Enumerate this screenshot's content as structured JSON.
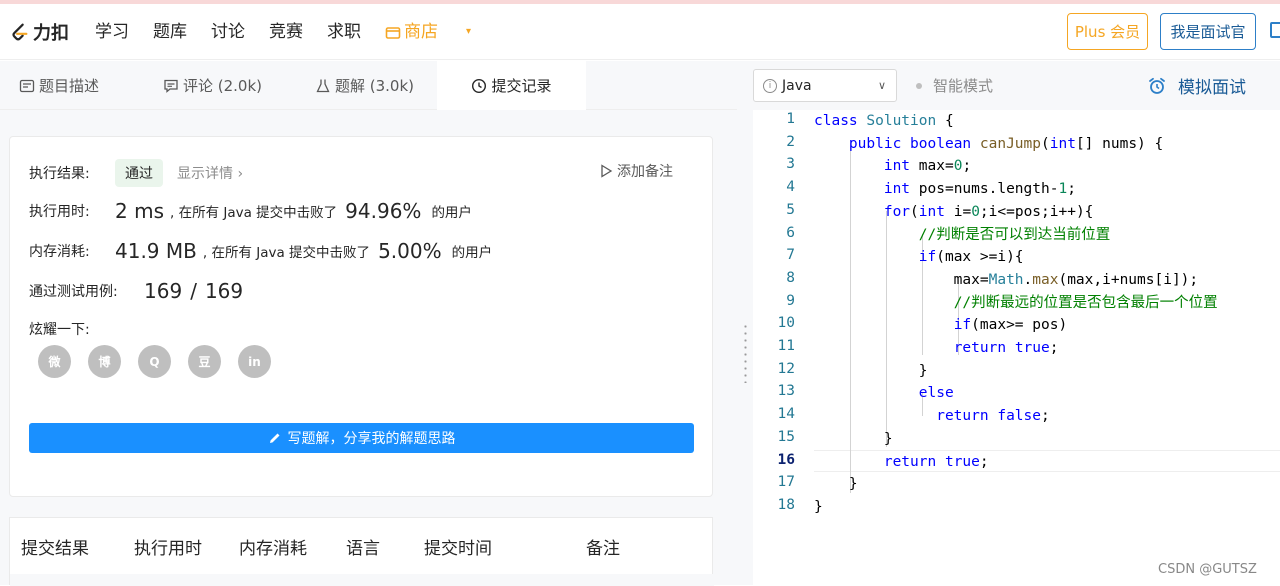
{
  "navbar": {
    "logo_text": "力扣",
    "links": [
      "学习",
      "题库",
      "讨论",
      "竞赛",
      "求职"
    ],
    "shop_label": "商店",
    "plus_label": "Plus 会员",
    "interviewer_label": "我是面试官",
    "accent_color": "#f5a623"
  },
  "tabs": [
    {
      "label": "题目描述",
      "icon": "description-icon"
    },
    {
      "label": "评论 (2.0k)",
      "icon": "comment-icon"
    },
    {
      "label": "题解 (3.0k)",
      "icon": "flask-icon"
    },
    {
      "label": "提交记录",
      "icon": "clock-icon"
    }
  ],
  "result": {
    "exec_result_label": "执行结果:",
    "status": "通过",
    "show_details": "显示详情",
    "add_note": "添加备注",
    "runtime_label": "执行用时:",
    "runtime_value": "2 ms",
    "runtime_beat_text": ", 在所有 Java 提交中击败了",
    "runtime_percent": "94.96%",
    "users_text": "的用户",
    "memory_label": "内存消耗:",
    "memory_value": "41.9 MB",
    "memory_beat_text": ", 在所有 Java 提交中击败了",
    "memory_percent": "5.00%",
    "memory_users_text": "的用户",
    "tests_label": "通过测试用例:",
    "tests_passed": "169",
    "tests_sep": "/",
    "tests_total": "169",
    "share_label": "炫耀一下:",
    "share_icons": [
      "wechat-icon",
      "weibo-icon",
      "qq-icon",
      "douban-icon",
      "linkedin-icon"
    ],
    "share_glyphs": [
      "微",
      "博",
      "Q",
      "豆",
      "in"
    ],
    "write_solution": "写题解，分享我的解题思路"
  },
  "history_table": {
    "columns": [
      "提交结果",
      "执行用时",
      "内存消耗",
      "语言",
      "提交时间",
      "备注"
    ]
  },
  "editor_toolbar": {
    "language": "Java",
    "smart_mode": "智能模式",
    "mock_interview": "模拟面试"
  },
  "code_lines": [
    "class Solution {",
    "    public boolean canJump(int[] nums) {",
    "        int max=0;",
    "        int pos=nums.length-1;",
    "        for(int i=0;i<=pos;i++){",
    "            //判断是否可以到达当前位置",
    "            if(max >=i){",
    "                max=Math.max(max,i+nums[i]);",
    "                //判断最远的位置是否包含最后一个位置",
    "                if(max>= pos)",
    "                return true;",
    "            }",
    "            else",
    "              return false;",
    "        }",
    "        return true;",
    "    }",
    "}"
  ],
  "current_line": 16,
  "watermark": "CSDN @GUTSZ"
}
